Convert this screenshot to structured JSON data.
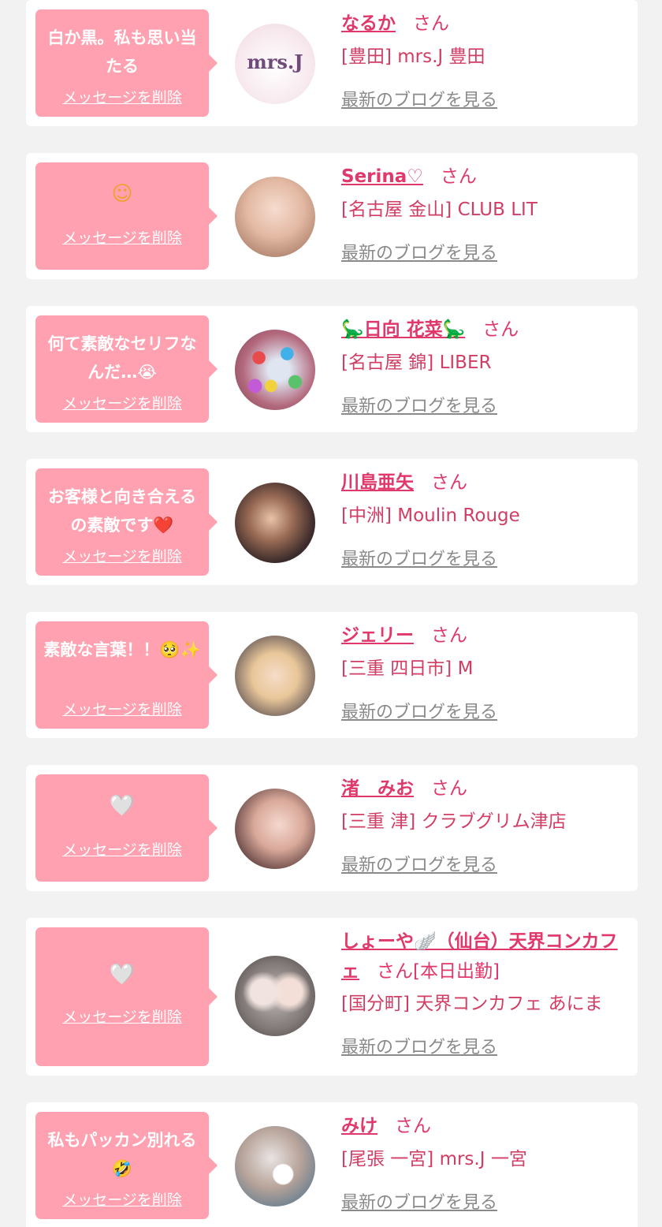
{
  "colors": {
    "bubble": "#ffa1b0",
    "name": "#e0386a",
    "shop": "#d23d64",
    "blog_link": "#8a8a8a",
    "page_bg": "#f2f2f2",
    "card_bg": "#ffffff"
  },
  "delete_label": "メッセージを削除",
  "san_label": "さん",
  "blog_label": "最新のブログを見る",
  "items": [
    {
      "message": "白か黒。私も思い当たる",
      "name": "なるか",
      "san": "さん",
      "shop": "[豊田] mrs.J 豊田",
      "avatar_logo": "mrs.J"
    },
    {
      "message": "☺",
      "name": "Serina♡",
      "san": "さん",
      "shop": "[名古屋 金山] CLUB LIT"
    },
    {
      "message": "何て素敵なセリフなんだ…😭",
      "name": "🦕日向 花菜🦕",
      "san": "さん",
      "shop": "[名古屋 錦] LIBER"
    },
    {
      "message": "お客様と向き合えるの素敵です❤️",
      "name": "川島亜矢",
      "san": "さん",
      "shop": "[中洲] Moulin Rouge"
    },
    {
      "message": "素敵な言葉！！🥺✨",
      "name": "ジェリー",
      "san": "さん",
      "shop": "[三重 四日市] M"
    },
    {
      "message": "🤍",
      "name": "渚　みお",
      "san": "さん",
      "shop": "[三重 津] クラブグリム津店"
    },
    {
      "message": "🤍",
      "name": "しょーや🪽（仙台）天界コンカフェ",
      "san": "さん[本日出勤]",
      "shop": "[国分町] 天界コンカフェ あにま"
    },
    {
      "message": "私もパッカン別れる🤣",
      "name": "みけ",
      "san": "さん",
      "shop": "[尾張 一宮] mrs.J 一宮"
    }
  ]
}
